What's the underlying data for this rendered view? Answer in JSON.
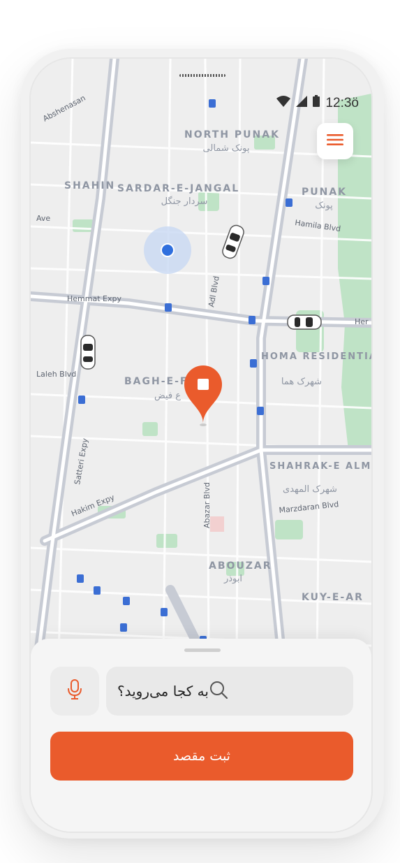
{
  "status_bar": {
    "time": "12:3ö",
    "icons": [
      "wifi-icon",
      "signal-icon",
      "battery-icon"
    ]
  },
  "map": {
    "areas": [
      {
        "en": "NORTH PUNAK",
        "fa": "پونک شمالی"
      },
      {
        "en": "SHAHIN",
        "fa": ""
      },
      {
        "en": "SARDAR-E-JANGAL",
        "fa": "سردار جنگل"
      },
      {
        "en": "PUNAK",
        "fa": "پونک"
      },
      {
        "en": "HOMA RESIDENTIAL AREA",
        "fa": "شهرک هما"
      },
      {
        "en": "BAGH-E-F",
        "fa": "ع فیض"
      },
      {
        "en": "SHAHRAK-E ALMAHDI",
        "fa": "شهرک المهدی"
      },
      {
        "en": "ABOUZAR",
        "fa": "ابوذر"
      },
      {
        "en": "KUY-E-AR",
        "fa": ""
      }
    ],
    "streets": [
      "Hemmat Expy",
      "Hamila Blvd",
      "Adl Blvd",
      "Satteri Expy",
      "Laleh Blvd",
      "Hakim Expy",
      "Abazar Blvd",
      "Marzdaran Blvd",
      "Ave",
      "Abshenasan",
      "Her"
    ],
    "colors": {
      "accent": "#ea5b2c",
      "location_dot": "#2f6fde"
    }
  },
  "bottom_sheet": {
    "search_placeholder": "به کجا می‌روید؟",
    "submit_label": "ثبت مقصد"
  }
}
